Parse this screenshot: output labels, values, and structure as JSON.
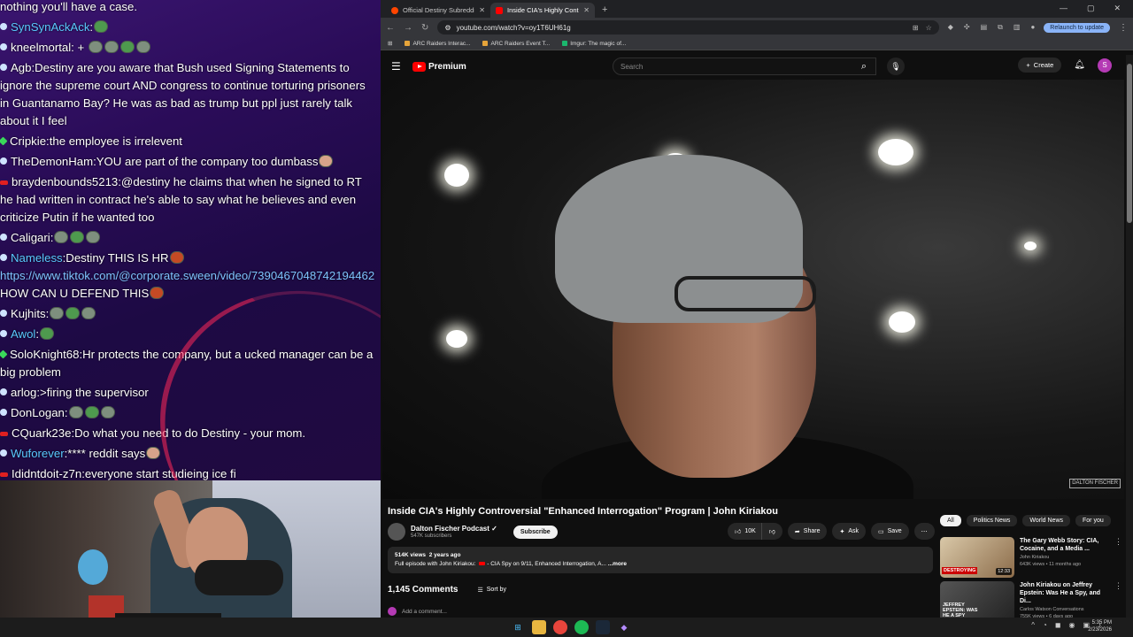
{
  "chat": {
    "messages": [
      {
        "user": "",
        "text": "nothing you'll have a case.",
        "dot": "",
        "color": ""
      },
      {
        "user": "SynSynAckAck",
        "text": ":",
        "dot": "blue",
        "color": "blue",
        "emotes": [
          "g"
        ]
      },
      {
        "user": "kneelmortal",
        "text": ": + ",
        "dot": "blue",
        "color": "",
        "emotes": [
          "",
          "",
          "g",
          ""
        ]
      },
      {
        "user": "Agb",
        "text": ":Destiny are you aware that Bush used Signing Statements to ignore the supreme court AND congress to continue torturing prisoners in Guantanamo Bay? He was as bad as trump but ppl just rarely talk about it I feel",
        "dot": "blue",
        "color": ""
      },
      {
        "user": "Cripkie",
        "text": ":the employee is irrelevent",
        "dot": "green",
        "color": ""
      },
      {
        "user": "TheDemonHam",
        "text": ":YOU are part of the company too dumbass",
        "dot": "blue",
        "color": "",
        "emotes": [
          "p"
        ]
      },
      {
        "user": "braydenbounds5213",
        "text": ":@destiny he claims that when he signed to RT he had written in contract he's able to say what he believes and even criticize Putin if he wanted too",
        "dot": "red",
        "color": ""
      },
      {
        "user": "Caligari",
        "text": ":",
        "dot": "blue",
        "color": "",
        "emotes": [
          "",
          "g",
          ""
        ]
      },
      {
        "user": "Nameless",
        "text": ":Destiny THIS IS HR",
        "dot": "blue",
        "color": "blue",
        "emotes": [
          "o"
        ],
        "link": "https://www.tiktok.com/@corporate.sween/video/7390467048742194462",
        "tail": " HOW CAN U DEFEND THIS",
        "tail_emote": "o"
      },
      {
        "user": "Kujhits",
        "text": ":",
        "dot": "blue",
        "color": "",
        "emotes": [
          "",
          "g",
          ""
        ]
      },
      {
        "user": "Awol",
        "text": ":",
        "dot": "blue",
        "color": "blue",
        "emotes": [
          "g"
        ]
      },
      {
        "user": "SoloKnight68",
        "text": ":Hr protects the company, but a ucked manager can be a big problem",
        "dot": "green",
        "color": ""
      },
      {
        "user": "arlog",
        "text": ":>firing the supervisor",
        "dot": "blue",
        "color": ""
      },
      {
        "user": "DonLogan",
        "text": ":",
        "dot": "blue",
        "color": "",
        "emotes": [
          "",
          "g",
          ""
        ]
      },
      {
        "user": "CQuark23e",
        "text": ":Do what you need to do Destiny - your mom.",
        "dot": "red",
        "color": ""
      },
      {
        "user": "Wuforever",
        "text": ":**** reddit says",
        "dot": "blue",
        "color": "blue",
        "emotes": [
          "p"
        ]
      },
      {
        "user": "Ididntdoit-z7n",
        "text": ":everyone start studieing ice fi",
        "dot": "red",
        "color": ""
      }
    ]
  },
  "browser": {
    "tabs": [
      {
        "title": "Official Destiny Subreddit",
        "active": false
      },
      {
        "title": "Inside CIA's Highly Controversi",
        "active": true
      }
    ],
    "url": "youtube.com/watch?v=oy1T6UH61g",
    "relaunch_label": "Relaunch to update",
    "bookmarks": [
      "ARC Raiders Interac...",
      "ARC Raiders Event T...",
      "Imgur: The magic of..."
    ]
  },
  "youtube": {
    "logo_text": "Premium",
    "search_placeholder": "Search",
    "create_label": "Create",
    "avatar_letter": "S",
    "video_watermark": "DALTON FISCHER",
    "title": "Inside CIA's Highly Controversial \"Enhanced Interrogation\" Program | John Kiriakou",
    "channel_name": "Dalton Fischer Podcast",
    "subscribers": "547K subscribers",
    "subscribe_label": "Subscribe",
    "like_count": "10K",
    "share_label": "Share",
    "ask_label": "Ask",
    "save_label": "Save",
    "views": "514K views",
    "age": "2 years ago",
    "description_prefix": "Full episode with John Kiriakou:",
    "description_text": "- CIA Spy on 9/11, Enhanced Interrogation, A...",
    "more_label": "...more",
    "comments_count": "1,145 Comments",
    "sort_label": "Sort by",
    "add_comment_placeholder": "Add a comment...",
    "chips": [
      "All",
      "Politics News",
      "World News",
      "For you"
    ],
    "recommendations": [
      {
        "title": "The Gary Webb Story: CIA, Cocaine, and a Media ...",
        "channel": "John Kiriakou",
        "meta": "643K views • 11 months ago",
        "duration": "12:33",
        "thumb_text": "DESTROYING"
      },
      {
        "title": "John Kiriakou on Jeffrey Epstein: Was He a Spy, and Di...",
        "channel": "Carlos Watson Conversations",
        "meta": "755K views • 6 days ago",
        "duration": "",
        "thumb_text": "JEFFREY EPSTEIN: WAS HE A SPY"
      }
    ]
  },
  "taskbar": {
    "time": "5:35 PM",
    "date": "2/23/2026"
  }
}
